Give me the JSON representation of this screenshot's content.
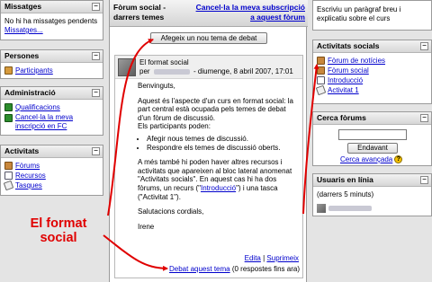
{
  "left": {
    "messages": {
      "title": "Missatges",
      "text": "No hi ha missatges pendents",
      "link": "Missatges..."
    },
    "people": {
      "title": "Persones",
      "items": [
        {
          "label": "Participants",
          "icon": "people-icon"
        }
      ]
    },
    "admin": {
      "title": "Administració",
      "items": [
        {
          "label": "Qualificacions",
          "icon": "grades-icon"
        },
        {
          "label": "Cancel·la la meva inscripció en FC",
          "icon": "unenrol-icon"
        }
      ]
    },
    "activities": {
      "title": "Activitats",
      "items": [
        {
          "label": "Fòrums",
          "icon": "forum-icon"
        },
        {
          "label": "Recursos",
          "icon": "resource-icon"
        },
        {
          "label": "Tasques",
          "icon": "assignment-icon"
        }
      ]
    }
  },
  "center": {
    "title": "Fòrum social - darrers temes",
    "subscribe": "Cancel·la la meva subscripció a aquest fòrum",
    "add_button": "Afegeix un nou tema de debat",
    "post": {
      "subject": "El format social",
      "by": "per",
      "date": "- diumenge, 8 abril 2007, 17:01",
      "greeting": "Benvinguts,",
      "p1": "Aquest és l'aspecte d'un curs en format social: la part central està ocupada pels temes de debat d'un fòrum de discussió.",
      "p2": "Els participants poden:",
      "bullets": [
        "Afegir nous temes de discussió.",
        "Respondre els temes de discussió oberts."
      ],
      "p3a": "A més també hi poden haver altres recursos i activitats que apareixen al bloc lateral anomenat \"Activitats socials\". En aquest cas hi ha dos fòrums, un recurs (\"",
      "p3link": "Introducció",
      "p3b": "\") i una tasca (\"Activitat 1\").",
      "closing": "Salutacions cordials,",
      "signature": "Irene",
      "edit": "Edita",
      "sep": "|",
      "delete": "Suprimeix"
    },
    "discuss_link": "Debat aquest tema",
    "replies": "(0 respostes fins ara)"
  },
  "annotation": {
    "line1": "El format",
    "line2": "social"
  },
  "right": {
    "summary": "Escriviu un paràgraf breu i explicatiu sobre el curs",
    "social": {
      "title": "Activitats socials",
      "items": [
        {
          "label": "Fòrum de notícies",
          "icon": "forum-icon"
        },
        {
          "label": "Fòrum social",
          "icon": "forum-icon"
        },
        {
          "label": "Introducció",
          "icon": "document-icon"
        },
        {
          "label": "Activitat 1",
          "icon": "assignment-icon"
        }
      ]
    },
    "search": {
      "title": "Cerca fòrums",
      "button": "Endavant",
      "advanced": "Cerca avançada",
      "input_value": ""
    },
    "online": {
      "title": "Usuaris en línia",
      "subtitle": "(darrers 5 minuts)"
    }
  },
  "colors": {
    "accent_link": "#0000cc",
    "annotation": "#e00000",
    "arrow": "#e00000"
  }
}
